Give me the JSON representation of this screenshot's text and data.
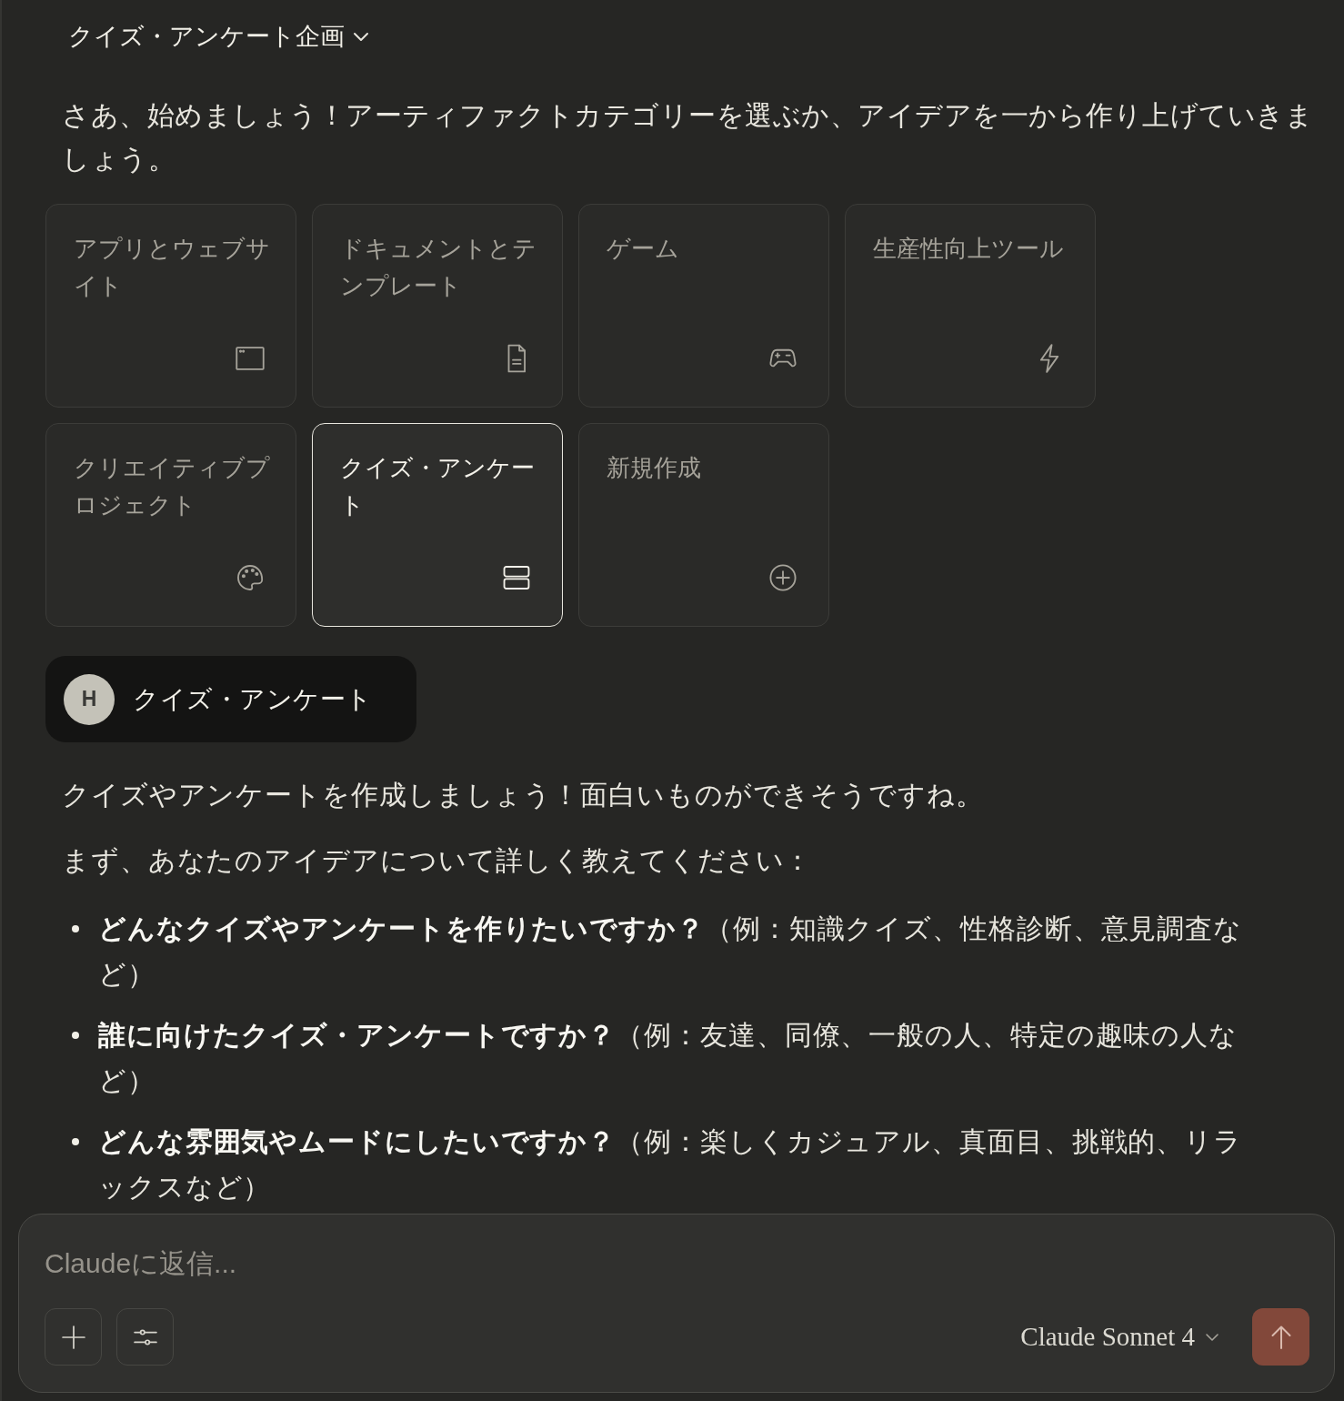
{
  "header": {
    "title": "クイズ・アンケート企画"
  },
  "intro": "さあ、始めましょう！アーティファクトカテゴリーを選ぶか、アイデアを一から作り上げていきましょう。",
  "categories": [
    {
      "label": "アプリとウェブサイト",
      "selected": false
    },
    {
      "label": "ドキュメントとテンプレート",
      "selected": false
    },
    {
      "label": "ゲーム",
      "selected": false
    },
    {
      "label": "生産性向上ツール",
      "selected": false
    },
    {
      "label": "クリエイティブプロジェクト",
      "selected": false
    },
    {
      "label": "クイズ・アンケート",
      "selected": true
    },
    {
      "label": "新規作成",
      "selected": false
    }
  ],
  "user_message": {
    "avatar": "H",
    "text": "クイズ・アンケート"
  },
  "response": {
    "paragraphs": [
      "クイズやアンケートを作成しましょう！面白いものができそうですね。",
      "まず、あなたのアイデアについて詳しく教えてください："
    ],
    "bullets": [
      "**どんなクイズやアンケートを作りたいですか？**（例：知識クイズ、性格診断、意見調査など）",
      "**誰に向けたクイズ・アンケートですか？**（例：友達、同僚、一般の人、特定の趣味の人など）",
      "**どんな雰囲気やムードにしたいですか？**（例：楽しくカジュアル、真面目、挑戦的、リラックスなど）"
    ]
  },
  "composer": {
    "placeholder": "Claudeに返信...",
    "model": "Claude Sonnet 4"
  }
}
